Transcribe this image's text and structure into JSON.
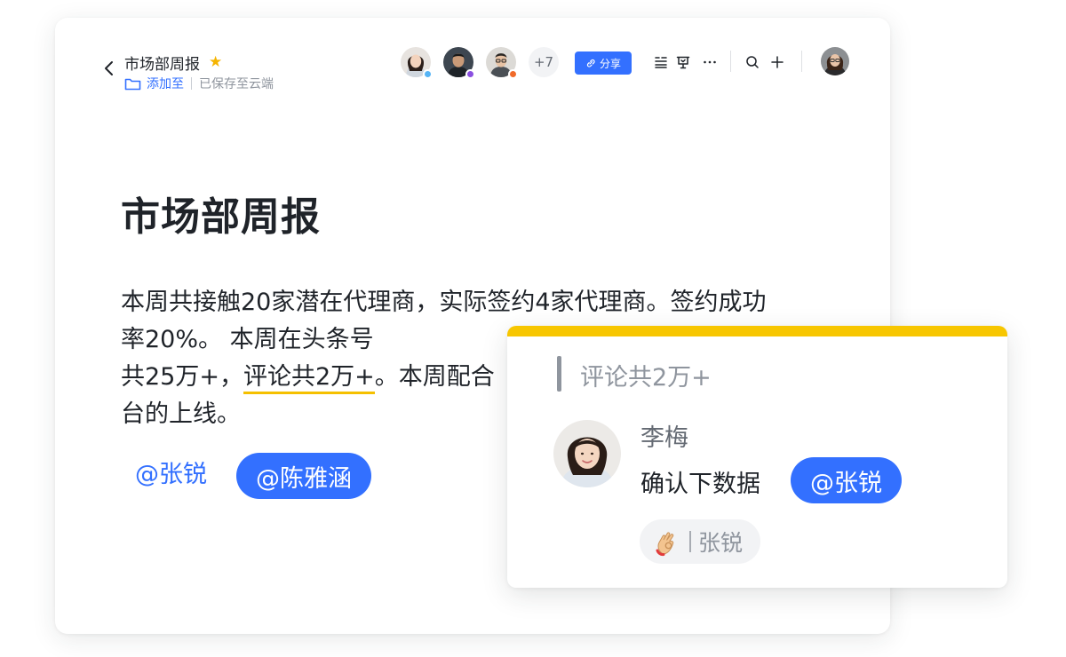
{
  "header": {
    "doc_name": "市场部周报",
    "add_to_label": "添加至",
    "saved_status": "已保存至云端",
    "collaborators_more": "+7",
    "share_label": "分享"
  },
  "document": {
    "title": "市场部周报",
    "paragraph_before": "本周共接触20家潜在代理商，实际签约4家代理商。签约成功率20%。 本周在头条号",
    "paragraph_line3_start": "共25万+，",
    "highlighted_text": "评论共2万+",
    "paragraph_after": "。本周配合",
    "paragraph_last": "台的上线。",
    "mention_plain": "@张锐",
    "mention_pill": "@陈雅涵"
  },
  "comment": {
    "quote": "评论共2万+",
    "author": "李梅",
    "text": "确认下数据",
    "mention": "@张锐",
    "reaction_user": "张锐"
  },
  "colors": {
    "accent": "#3370ff",
    "highlight": "#f7c600",
    "star": "#f5b400",
    "presence_dots": [
      "#56b4f5",
      "#8a4fe0",
      "#f06a2a"
    ]
  },
  "icons": {
    "back": "chevron-left-icon",
    "star": "star-icon",
    "folder": "folder-icon",
    "share": "link-icon",
    "outline": "outline-icon",
    "present": "presentation-icon",
    "more": "more-icon",
    "search": "search-icon",
    "add": "plus-icon",
    "reaction": "ok-hand-icon"
  }
}
